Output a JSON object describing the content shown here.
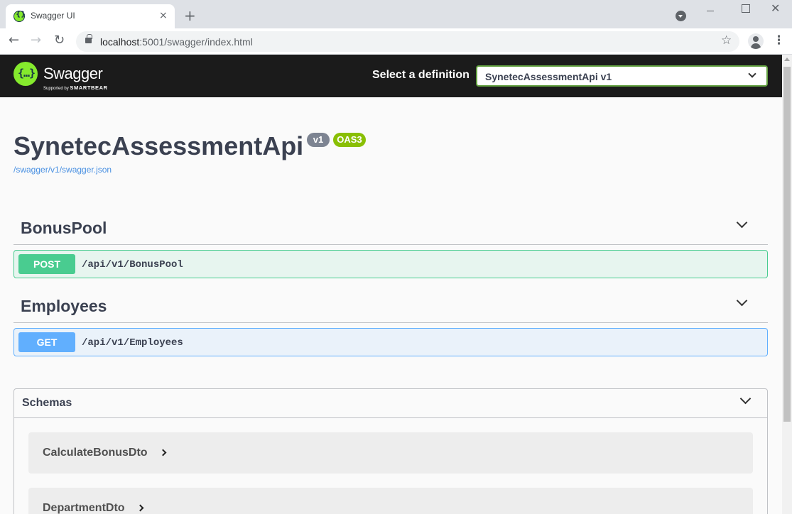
{
  "browser": {
    "tab_title": "Swagger UI",
    "tab_close": "×",
    "new_tab": "+",
    "url_host": "localhost",
    "url_rest": ":5001/swagger/index.html",
    "icons": [
      "back-arrow-icon",
      "forward-arrow-icon",
      "reload-icon",
      "lock-icon",
      "star-icon",
      "account-icon",
      "menu-icon"
    ]
  },
  "topbar": {
    "logo_text": "Swagger",
    "logo_sub": "Supported by",
    "logo_brand": "SMARTBEAR",
    "select_label": "Select a definition",
    "selected_definition": "SynetecAssessmentApi v1"
  },
  "info": {
    "title": "SynetecAssessmentApi",
    "version": "v1",
    "oas": "OAS3",
    "spec_link": "/swagger/v1/swagger.json"
  },
  "tags": [
    {
      "name": "BonusPool",
      "operation": {
        "method": "POST",
        "path": "/api/v1/BonusPool"
      }
    },
    {
      "name": "Employees",
      "operation": {
        "method": "GET",
        "path": "/api/v1/Employees"
      }
    }
  ],
  "schemas": {
    "title": "Schemas",
    "models": [
      "CalculateBonusDto",
      "DepartmentDto"
    ]
  },
  "colors": {
    "post": "#49cc90",
    "get": "#61affe",
    "topbar": "#1b1b1b",
    "accent_green": "#85ea2d"
  }
}
